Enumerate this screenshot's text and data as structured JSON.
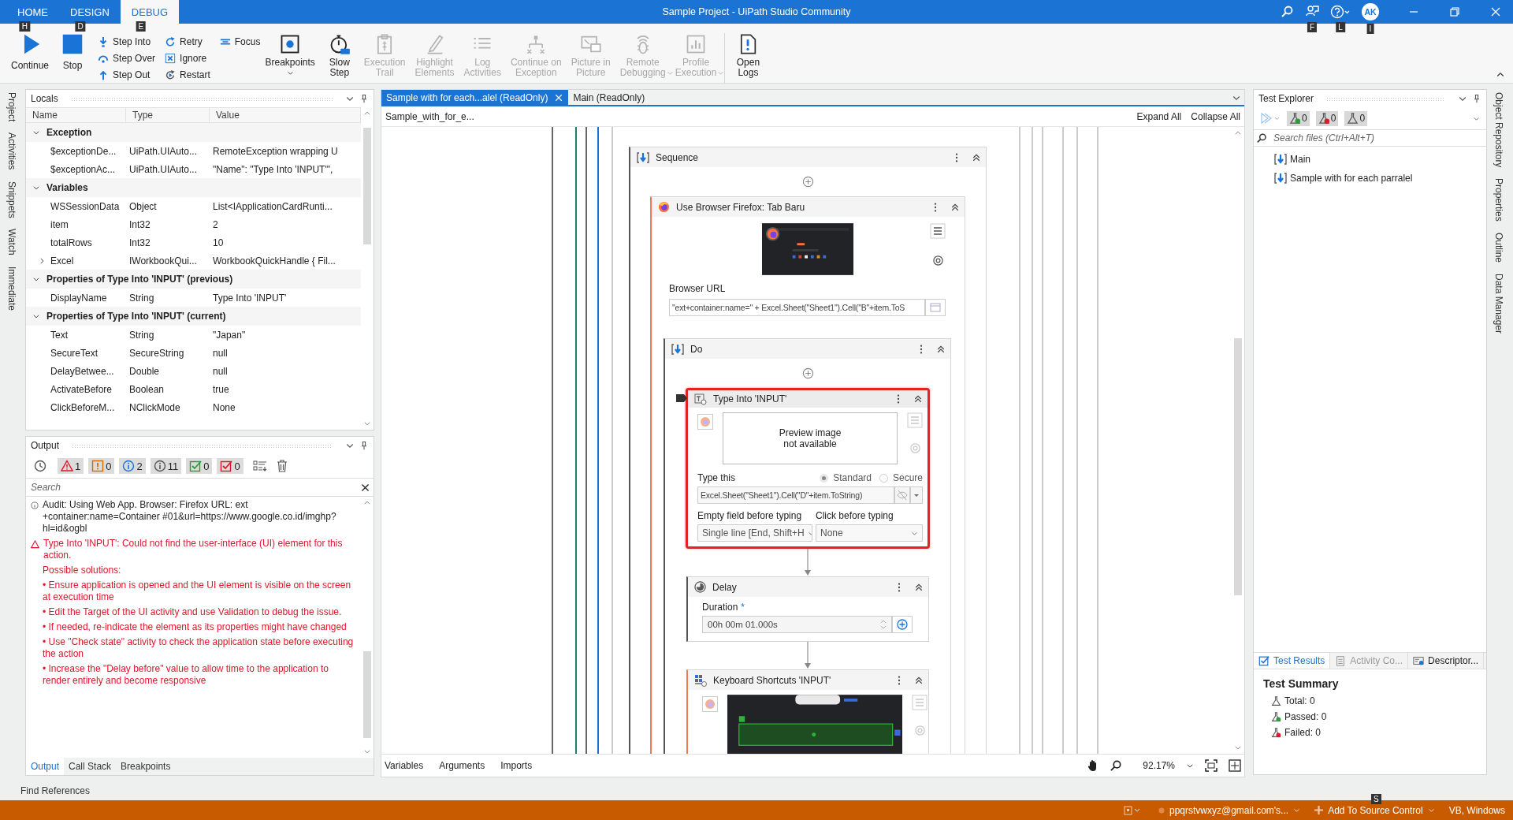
{
  "window": {
    "title": "Sample Project - UiPath Studio Community",
    "user_initials": "AK"
  },
  "ribbon_tabs": [
    {
      "label": "HOME",
      "key_tip": "H",
      "selected": false
    },
    {
      "label": "DESIGN",
      "key_tip": "D",
      "selected": false
    },
    {
      "label": "DEBUG",
      "key_tip": "E",
      "selected": true
    }
  ],
  "title_key_tips": [
    "F",
    "L",
    "I"
  ],
  "ribbon": {
    "main_buttons": [
      {
        "label": "Continue"
      },
      {
        "label": "Stop"
      }
    ],
    "step_buttons": [
      {
        "label": "Step Into"
      },
      {
        "label": "Step Over"
      },
      {
        "label": "Step Out"
      },
      {
        "label": "Retry"
      },
      {
        "label": "Ignore"
      },
      {
        "label": "Restart"
      },
      {
        "label": "Focus"
      }
    ],
    "tool_buttons": [
      {
        "label": "Breakpoints",
        "disabled": false,
        "dropdown": true
      },
      {
        "label": "Slow\nStep",
        "disabled": false,
        "dropdown": false
      },
      {
        "label": "Execution\nTrail",
        "disabled": true,
        "dropdown": false
      },
      {
        "label": "Highlight\nElements",
        "disabled": true,
        "dropdown": false
      },
      {
        "label": "Log\nActivities",
        "disabled": true,
        "dropdown": false
      },
      {
        "label": "Continue on\nException",
        "disabled": true,
        "dropdown": false
      },
      {
        "label": "Picture in\nPicture",
        "disabled": true,
        "dropdown": false
      },
      {
        "label": "Remote\nDebugging",
        "disabled": true,
        "dropdown": true
      },
      {
        "label": "Profile\nExecution",
        "disabled": true,
        "dropdown": true
      }
    ],
    "logs_button": {
      "label": "Open\nLogs"
    }
  },
  "left_dock": [
    "Project",
    "Activities",
    "Snippets",
    "Watch",
    "Immediate"
  ],
  "right_dock": [
    "Object Repository",
    "Properties",
    "Outline",
    "Data Manager"
  ],
  "locals": {
    "title": "Locals",
    "columns": [
      "Name",
      "Type",
      "Value"
    ],
    "groups": [
      {
        "title": "Exception",
        "expanded": true,
        "rows": [
          {
            "kind": "value",
            "name": "$exceptionDe...",
            "type": "UiPath.UIAuto...",
            "value": "RemoteException wrapping U"
          },
          {
            "kind": "value",
            "name": "$exceptionAc...",
            "type": "UiPath.UIAuto...",
            "value": "\"Name\": \"Type Into 'INPUT'\","
          }
        ]
      },
      {
        "title": "Variables",
        "expanded": true,
        "rows": [
          {
            "kind": "value",
            "name": "WSSessionData",
            "type": "Object",
            "value": "List<IApplicationCardRunti..."
          },
          {
            "kind": "value",
            "name": "item",
            "type": "Int32",
            "value": "2"
          },
          {
            "kind": "value",
            "name": "totalRows",
            "type": "Int32",
            "value": "10"
          },
          {
            "kind": "object",
            "name": "Excel",
            "type": "IWorkbookQui...",
            "value": "WorkbookQuickHandle { Fil..."
          }
        ]
      },
      {
        "title": "Properties of Type Into 'INPUT' (previous)",
        "expanded": true,
        "rows": [
          {
            "kind": "value",
            "name": "DisplayName",
            "type": "String",
            "value": "Type Into 'INPUT'"
          }
        ]
      },
      {
        "title": "Properties of Type Into 'INPUT' (current)",
        "expanded": true,
        "rows": [
          {
            "kind": "value",
            "name": "Text",
            "type": "String",
            "value": "\"Japan\""
          },
          {
            "kind": "value",
            "name": "SecureText",
            "type": "SecureString",
            "value": "null"
          },
          {
            "kind": "value",
            "name": "DelayBetwee...",
            "type": "Double",
            "value": "null"
          },
          {
            "kind": "value",
            "name": "ActivateBefore",
            "type": "Boolean",
            "value": "true"
          },
          {
            "kind": "value",
            "name": "ClickBeforeM...",
            "type": "NClickMode",
            "value": "None"
          }
        ]
      }
    ]
  },
  "output": {
    "title": "Output",
    "filters": [
      {
        "kind": "error",
        "count": "1",
        "selected": true
      },
      {
        "kind": "warning",
        "count": "0",
        "selected": true
      },
      {
        "kind": "info",
        "count": "2",
        "selected": true
      },
      {
        "kind": "trace",
        "count": "11",
        "selected": true
      },
      {
        "kind": "success",
        "count": "0",
        "selected": true
      },
      {
        "kind": "failure",
        "count": "0",
        "selected": true
      }
    ],
    "search_placeholder": "Search",
    "messages": [
      {
        "kind": "trace",
        "text": "Audit: Using Web App. Browser: Firefox URL: ext +container:name=Container #01&url=https://www.google.co.id/imghp?hl=id&ogbl"
      },
      {
        "kind": "error",
        "text": "Type Into 'INPUT': Could not find the user-interface (UI) element for this action.",
        "heading": "Possible solutions:",
        "bullets": [
          "• Ensure application is opened and the UI element is visible on the screen at execution time",
          "• Edit the Target of the UI activity and use Validation to debug the issue.",
          "• If needed, re-indicate the element as its properties might have changed",
          "• Use \"Check state\" activity to check the application state before executing the action",
          "• Increase the \"Delay before\" value to allow time to the application to render entirely and become responsive"
        ]
      }
    ],
    "tabs": [
      {
        "label": "Output",
        "selected": true
      },
      {
        "label": "Call Stack",
        "selected": false
      },
      {
        "label": "Breakpoints",
        "selected": false
      }
    ]
  },
  "find_references": "Find References",
  "designer": {
    "tabs": [
      {
        "label": "Sample with for each...alel (ReadOnly)",
        "selected": true
      },
      {
        "label": "Main (ReadOnly)",
        "selected": false
      }
    ],
    "breadcrumb": "Sample_with_for_e...",
    "expand_all": "Expand All",
    "collapse_all": "Collapse All",
    "workflow": {
      "sequence": {
        "title": "Sequence"
      },
      "use_browser": {
        "title": "Use Browser Firefox: Tab Baru",
        "url_label": "Browser URL",
        "url_value": "\"ext+container:name=\" + Excel.Sheet(\"Sheet1\").Cell(\"B\"+item.ToS"
      },
      "do": {
        "title": "Do"
      },
      "type_into": {
        "title": "Type Into 'INPUT'",
        "error": true,
        "preview": "Preview image\nnot available",
        "type_label": "Type this",
        "modes": [
          {
            "label": "Standard",
            "selected": true
          },
          {
            "label": "Secure",
            "selected": false
          }
        ],
        "value": "Excel.Sheet(\"Sheet1\").Cell(\"D\"+item.ToString)",
        "empty_label": "Empty field before typing",
        "empty_value": "Single line [End, Shift+H",
        "click_label": "Click before typing",
        "click_value": "None"
      },
      "delay": {
        "title": "Delay",
        "duration_label": "Duration",
        "required_mark": "*",
        "value": "00h 00m 01.000s"
      },
      "keyboard": {
        "title": "Keyboard Shortcuts 'INPUT'"
      }
    },
    "bottom_tabs": [
      "Variables",
      "Arguments",
      "Imports"
    ],
    "zoom": "92.17%"
  },
  "test_explorer": {
    "title": "Test Explorer",
    "counters": [
      {
        "kind": "passed",
        "count": "0"
      },
      {
        "kind": "failed",
        "count": "0"
      },
      {
        "kind": "all",
        "count": "0"
      }
    ],
    "search_placeholder": "Search files (Ctrl+Alt+T)",
    "files": [
      "Main",
      "Sample with for each parralel"
    ],
    "tabs": [
      {
        "label": "Test Results",
        "selected": true
      },
      {
        "label": "Activity Co...",
        "selected": false
      },
      {
        "label": "Descriptor...",
        "selected": false
      }
    ],
    "summary": {
      "title": "Test Summary",
      "lines": [
        {
          "kind": "total",
          "text": "Total: 0"
        },
        {
          "kind": "passed",
          "text": "Passed: 0"
        },
        {
          "kind": "failed",
          "text": "Failed: 0"
        }
      ]
    }
  },
  "status_bar": {
    "key_tip": "S",
    "account": "ppqrstvwxyz@gmail.com's...",
    "source_control": "Add To Source Control",
    "language": "VB, Windows"
  }
}
